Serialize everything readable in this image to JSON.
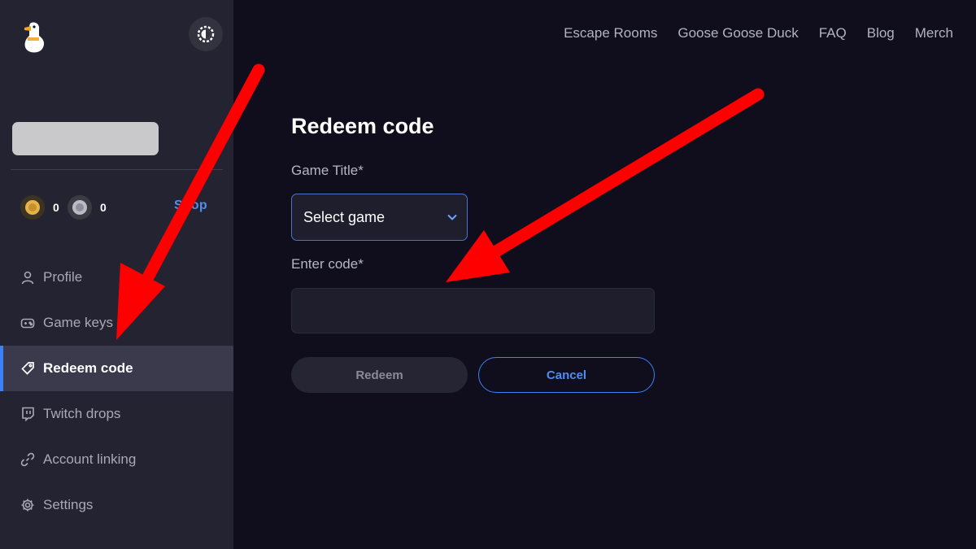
{
  "topnav": {
    "items": [
      "Escape Rooms",
      "Goose Goose Duck",
      "FAQ",
      "Blog",
      "Merch"
    ]
  },
  "sidebar": {
    "gold_count": "0",
    "silver_count": "0",
    "shop_label": "Shop",
    "items": [
      {
        "label": "Profile",
        "icon": "user-icon"
      },
      {
        "label": "Game keys",
        "icon": "gamepad-icon"
      },
      {
        "label": "Redeem code",
        "icon": "tag-icon",
        "active": true
      },
      {
        "label": "Twitch drops",
        "icon": "twitch-icon"
      },
      {
        "label": "Account linking",
        "icon": "link-icon"
      },
      {
        "label": "Settings",
        "icon": "gear-icon"
      }
    ]
  },
  "form": {
    "title": "Redeem code",
    "game_title_label": "Game Title*",
    "select_value": "Select game",
    "code_label": "Enter code*",
    "code_value": "",
    "redeem_label": "Redeem",
    "cancel_label": "Cancel"
  },
  "colors": {
    "background": "#100e1d",
    "sidebar": "#232331",
    "accent": "#3b82f6",
    "annotation_arrow": "#ff0000"
  }
}
